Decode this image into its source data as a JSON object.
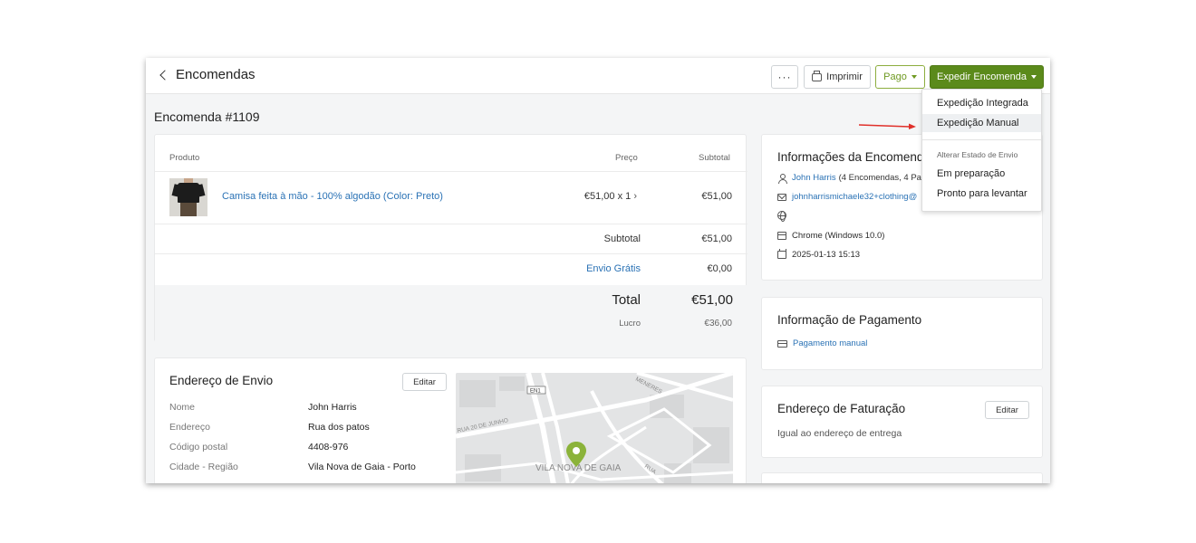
{
  "topbar": {
    "back_label": "Encomendas",
    "more_label": "···",
    "print_label": "Imprimir",
    "paid_label": "Pago",
    "ship_label": "Expedir Encomenda"
  },
  "page_title": "Encomenda #1109",
  "products": {
    "headers": {
      "product": "Produto",
      "price": "Preço",
      "subtotal": "Subtotal"
    },
    "items": [
      {
        "name": "Camisa feita à mão - 100% algodão (Color: Preto)",
        "price_qty": "€51,00 x 1",
        "subtotal": "€51,00"
      }
    ],
    "subtotal_label": "Subtotal",
    "subtotal_value": "€51,00",
    "shipping_label": "Envio Grátis",
    "shipping_value": "€0,00",
    "total_label": "Total",
    "total_value": "€51,00",
    "profit_label": "Lucro",
    "profit_value": "€36,00"
  },
  "order_info": {
    "title": "Informações da Encomend",
    "customer": "John Harris",
    "customer_extra": "(4 Encomendas, 4 Pa",
    "email": "johnharrismichaele32+clothing@",
    "browser": "Chrome (Windows 10.0)",
    "date": "2025-01-13 15:13"
  },
  "payment_info": {
    "title": "Informação de Pagamento",
    "method": "Pagamento manual"
  },
  "billing": {
    "title": "Endereço de Faturação",
    "edit_label": "Editar",
    "text": "Igual ao endereço de entrega"
  },
  "shipping_address": {
    "title": "Endereço de Envio",
    "edit_label": "Editar",
    "rows": [
      {
        "key": "Nome",
        "value": "John Harris"
      },
      {
        "key": "Endereço",
        "value": "Rua dos patos"
      },
      {
        "key": "Código postal",
        "value": "4408-976"
      },
      {
        "key": "Cidade - Região",
        "value": "Vila Nova de Gaia - Porto"
      }
    ]
  },
  "map": {
    "street_1": "RUA 20 DE JUNHO",
    "street_2": "MENERES",
    "road_badge": "EN1",
    "city_label": "VILA NOVA DE GAIA",
    "street_3": "RUA"
  },
  "ship_menu": {
    "item_integrated": "Expedição Integrada",
    "item_manual": "Expedição Manual",
    "section_label": "Alterar Estado de Envio",
    "item_preparing": "Em preparação",
    "item_ready": "Pronto para levantar"
  },
  "colors": {
    "primary_green": "#5b8a1b",
    "link_blue": "#2a72b5",
    "annotation_red": "#e0302a"
  }
}
